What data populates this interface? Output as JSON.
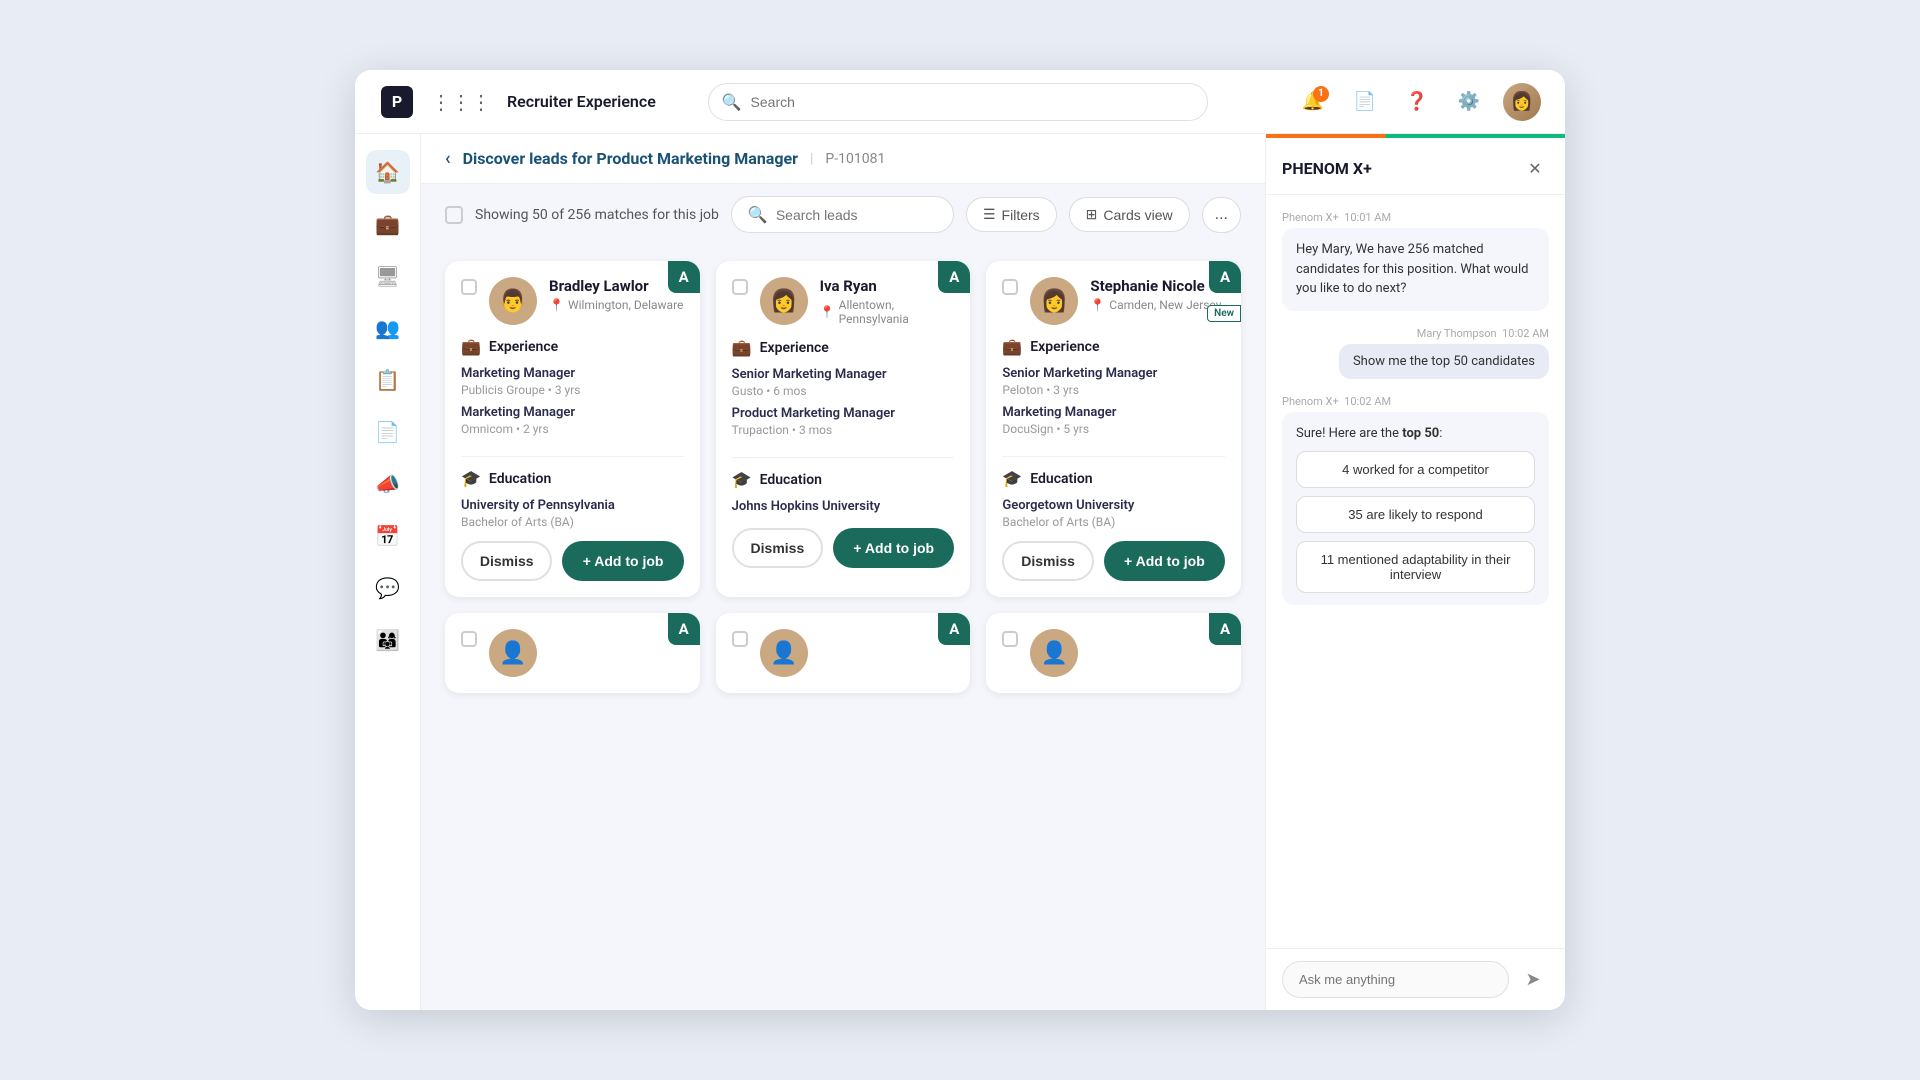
{
  "app": {
    "title": "Recruiter Experience",
    "logo_letter": "P"
  },
  "topnav": {
    "search_placeholder": "Search",
    "notification_badge": "1"
  },
  "breadcrumb": {
    "back_label": "‹",
    "title": "Discover leads for Product Marketing Manager",
    "divider": "|",
    "job_id": "P-101081"
  },
  "toolbar": {
    "count_text": "Showing 50 of 256 matches for this job",
    "search_placeholder": "Search leads",
    "filter_label": "Filters",
    "view_label": "Cards view",
    "more_label": "..."
  },
  "candidates": [
    {
      "name": "Bradley Lawlor",
      "location": "Wilmington, Delaware",
      "grade": "A",
      "is_new": false,
      "avatar_emoji": "👨",
      "experience": [
        {
          "title": "Marketing Manager",
          "detail": "Publicis Groupe • 3 yrs"
        },
        {
          "title": "Marketing Manager",
          "detail": "Omnicom • 2 yrs"
        }
      ],
      "education": [
        {
          "school": "University of Pennsylvania",
          "degree": "Bachelor of Arts (BA)"
        }
      ]
    },
    {
      "name": "Iva Ryan",
      "location": "Allentown, Pennsylvania",
      "grade": "A",
      "is_new": false,
      "avatar_emoji": "👩",
      "experience": [
        {
          "title": "Senior Marketing Manager",
          "detail": "Gusto • 6 mos"
        },
        {
          "title": "Product Marketing Manager",
          "detail": "Trupaction • 3 mos"
        }
      ],
      "education": [
        {
          "school": "Johns Hopkins University",
          "degree": ""
        }
      ]
    },
    {
      "name": "Stephanie Nicole",
      "location": "Camden, New Jersey",
      "grade": "A",
      "is_new": true,
      "avatar_emoji": "👩",
      "experience": [
        {
          "title": "Senior Marketing Manager",
          "detail": "Peloton • 3 yrs"
        },
        {
          "title": "Marketing Manager",
          "detail": "DocuSign • 5 yrs"
        }
      ],
      "education": [
        {
          "school": "Georgetown University",
          "degree": "Bachelor of Arts (BA)"
        }
      ]
    }
  ],
  "card_actions": {
    "dismiss": "Dismiss",
    "add": "+ Add to job"
  },
  "panel": {
    "title": "PHENOM X+",
    "close_label": "✕",
    "messages": [
      {
        "type": "bot",
        "sender": "Phenom X+",
        "time": "10:01 AM",
        "text": "Hey Mary, We have 256 matched candidates for this position. What would you like to do next?"
      },
      {
        "type": "user",
        "sender": "Mary Thompson",
        "time": "10:02 AM",
        "text": "Show me the top 50 candidates"
      },
      {
        "type": "bot",
        "sender": "Phenom X+",
        "time": "10:02 AM",
        "text_before": "Sure! Here are the ",
        "text_bold": "top 50",
        "text_after": ":",
        "insights": [
          "4 worked for a competitor",
          "35 are likely to respond",
          "11 mentioned adaptability in their interview"
        ]
      }
    ],
    "input_placeholder": "Ask me anything",
    "send_icon": "➤"
  },
  "sidebar_items": [
    {
      "icon": "🏠",
      "name": "home"
    },
    {
      "icon": "💼",
      "name": "jobs"
    },
    {
      "icon": "🖥",
      "name": "workspace"
    },
    {
      "icon": "👥",
      "name": "candidates"
    },
    {
      "icon": "📋",
      "name": "tasks"
    },
    {
      "icon": "📄",
      "name": "documents"
    },
    {
      "icon": "📣",
      "name": "campaigns"
    },
    {
      "icon": "📅",
      "name": "calendar"
    },
    {
      "icon": "💬",
      "name": "messages"
    },
    {
      "icon": "👨‍👩‍👧",
      "name": "teams"
    }
  ]
}
